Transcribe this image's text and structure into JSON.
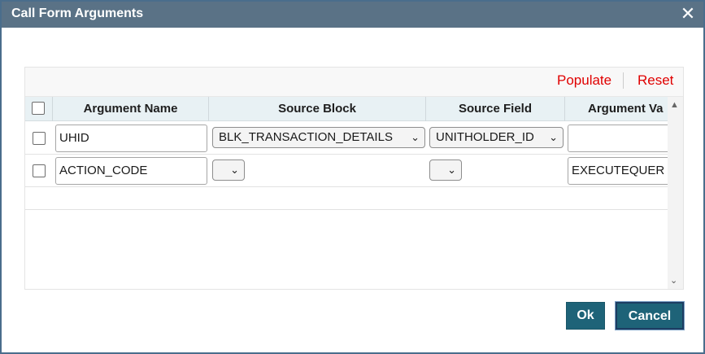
{
  "dialog": {
    "title": "Call Form Arguments",
    "close_symbol": "✕"
  },
  "toolbar": {
    "populate_label": "Populate",
    "reset_label": "Reset"
  },
  "grid": {
    "columns": [
      "Argument Name",
      "Source Block",
      "Source Field",
      "Argument Va"
    ],
    "rows": [
      {
        "argument_name": "UHID",
        "source_block": "BLK_TRANSACTION_DETAILS",
        "source_field": "UNITHOLDER_ID",
        "argument_value": ""
      },
      {
        "argument_name": "ACTION_CODE",
        "source_block": "",
        "source_field": "",
        "argument_value": "EXECUTEQUER"
      }
    ]
  },
  "buttons": {
    "ok_label": "Ok",
    "cancel_label": "Cancel"
  },
  "icons": {
    "dropdown": "chevron-down-icon",
    "close": "close-icon",
    "scroll": "scroll-arrow-icon"
  },
  "colors": {
    "titlebar": "#5a7286",
    "link_red": "#e00000",
    "button_teal": "#1e6378",
    "header_bg": "#e8f1f4"
  }
}
